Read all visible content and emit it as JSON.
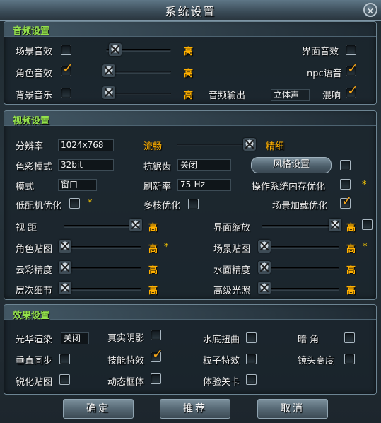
{
  "window": {
    "title": "系统设置",
    "close": "×"
  },
  "audio": {
    "header": "音频设置",
    "scene_sfx": {
      "label": "场景音效",
      "level": "高",
      "checked": false
    },
    "ui_sfx": {
      "label": "界面音效",
      "checked": false
    },
    "char_sfx": {
      "label": "角色音效",
      "level": "高",
      "checked": true
    },
    "npc_voice": {
      "label": "npc语音",
      "checked": true
    },
    "bgm": {
      "label": "背景音乐",
      "level": "高",
      "checked": false
    },
    "output": {
      "label": "音频输出",
      "value": "立体声"
    },
    "reverb": {
      "label": "混响",
      "checked": true
    }
  },
  "video": {
    "header": "视频设置",
    "resolution": {
      "label": "分辨率",
      "value": "1024x768"
    },
    "quality": {
      "low": "流畅",
      "high": "精细"
    },
    "color_mode": {
      "label": "色彩模式",
      "value": "32bit"
    },
    "antialias": {
      "label": "抗锯齿",
      "value": "关闭"
    },
    "style_button": "风格设置",
    "style_checked": false,
    "mode": {
      "label": "模式",
      "value": "窗口"
    },
    "refresh": {
      "label": "刷新率",
      "value": "75-Hz"
    },
    "mem_opt": {
      "label": "操作系统内存优化",
      "checked": false
    },
    "low_spec": {
      "label": "低配机优化",
      "checked": false
    },
    "multicore": {
      "label": "多核优化",
      "checked": false
    },
    "scene_load": {
      "label": "场景加载优化",
      "checked": true
    },
    "view_dist": {
      "label": "视    距",
      "level": "高"
    },
    "ui_scale": {
      "label": "界面缩放",
      "level": "高",
      "checked": false
    },
    "char_tex": {
      "label": "角色贴图",
      "level": "高"
    },
    "scene_tex": {
      "label": "场景贴图",
      "level": "高"
    },
    "cloud": {
      "label": "云彩精度",
      "level": "高"
    },
    "water": {
      "label": "水面精度",
      "level": "高"
    },
    "lod": {
      "label": "层次细节",
      "level": "高"
    },
    "hdr": {
      "label": "高级光照",
      "level": "高"
    },
    "star": "*"
  },
  "effects": {
    "header": "效果设置",
    "bloom": {
      "label": "光华渲染",
      "value": "关闭"
    },
    "shadow": {
      "label": "真实阴影",
      "checked": false
    },
    "underwater": {
      "label": "水底扭曲",
      "checked": false
    },
    "dark_corner": {
      "label": "暗    角",
      "checked": false
    },
    "vsync": {
      "label": "垂直同步",
      "checked": false
    },
    "skill_fx": {
      "label": "技能特效",
      "checked": true
    },
    "particle": {
      "label": "粒子特效",
      "checked": false
    },
    "cam_height": {
      "label": "镜头高度",
      "checked": false
    },
    "sharpen": {
      "label": "锐化贴图",
      "checked": false
    },
    "dyn_frame": {
      "label": "动态框体",
      "checked": false
    },
    "trial": {
      "label": "体验关卡",
      "checked": false
    }
  },
  "footer": {
    "ok": "确定",
    "recommend": "推荐",
    "cancel": "取消"
  },
  "colors": {
    "section_title": "#93e04b",
    "accent": "#ffb000",
    "check": "#f3a51a"
  }
}
